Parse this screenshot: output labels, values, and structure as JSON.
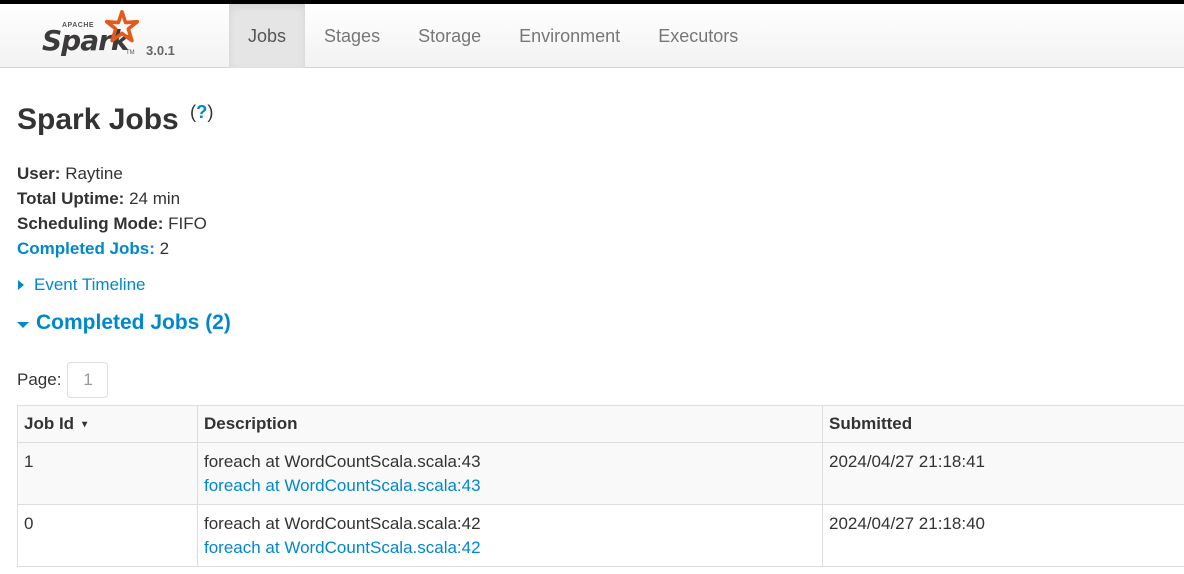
{
  "brand": {
    "apache": "APACHE",
    "name": "Spark",
    "tm": "TM",
    "version": "3.0.1",
    "star_color": "#e25a1c"
  },
  "nav": {
    "tabs": [
      {
        "label": "Jobs",
        "active": true
      },
      {
        "label": "Stages",
        "active": false
      },
      {
        "label": "Storage",
        "active": false
      },
      {
        "label": "Environment",
        "active": false
      },
      {
        "label": "Executors",
        "active": false
      }
    ]
  },
  "page": {
    "title": "Spark Jobs",
    "help_open": "(",
    "help_q": "?",
    "help_close": ")"
  },
  "summary": {
    "user_label": "User:",
    "user_value": "Raytine",
    "uptime_label": "Total Uptime:",
    "uptime_value": "24 min",
    "mode_label": "Scheduling Mode:",
    "mode_value": "FIFO",
    "completed_label": "Completed Jobs:",
    "completed_value": "2"
  },
  "timeline": {
    "label": "Event Timeline"
  },
  "completed_section": {
    "label": "Completed Jobs (2)"
  },
  "pager": {
    "label": "Page:",
    "current": "1"
  },
  "table": {
    "headers": {
      "job_id": "Job Id",
      "sort_icon": "▾",
      "description": "Description",
      "submitted": "Submitted"
    },
    "rows": [
      {
        "job_id": "1",
        "desc_text": "foreach at WordCountScala.scala:43",
        "desc_link": "foreach at WordCountScala.scala:43",
        "submitted": "2024/04/27 21:18:41"
      },
      {
        "job_id": "0",
        "desc_text": "foreach at WordCountScala.scala:42",
        "desc_link": "foreach at WordCountScala.scala:42",
        "submitted": "2024/04/27 21:18:40"
      }
    ]
  },
  "colors": {
    "link": "#0088cc",
    "text": "#333333"
  }
}
